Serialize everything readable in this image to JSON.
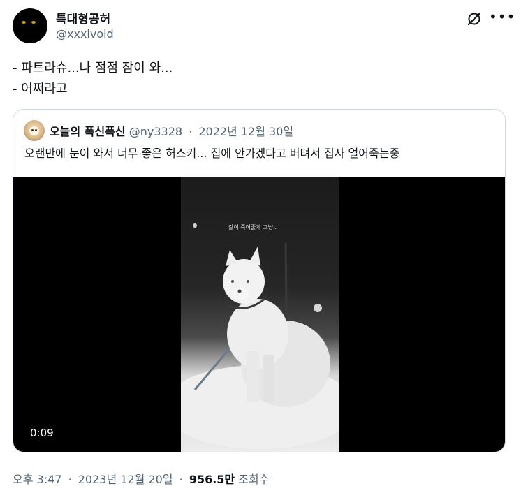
{
  "author": {
    "name": "특대형공허",
    "handle": "@xxxlvoid"
  },
  "tweet": {
    "lines": [
      "- 파트라슈...나 점점 잠이 와...",
      "- 어쩌라고"
    ]
  },
  "quoted": {
    "name": "오늘의 폭신폭신",
    "handle": "@ny3328",
    "separator": "·",
    "date": "2022년 12월 30일",
    "text": "오랜만에 눈이 와서 너무 좋은 허스키... 집에 안가겠다고 버텨서 집사 얼어죽는중",
    "video": {
      "caption": "같이 죽어줄게 그냥..",
      "duration": "0:09"
    }
  },
  "footer": {
    "time": "오후 3:47",
    "separator": "·",
    "date": "2023년 12월 20일",
    "views": "956.5만",
    "views_label": "조회수"
  },
  "icons": {
    "grok": "grok-icon",
    "more": "more-icon"
  },
  "colors": {
    "text": "#0f1419",
    "muted": "#536471",
    "border": "#cfd9de"
  }
}
